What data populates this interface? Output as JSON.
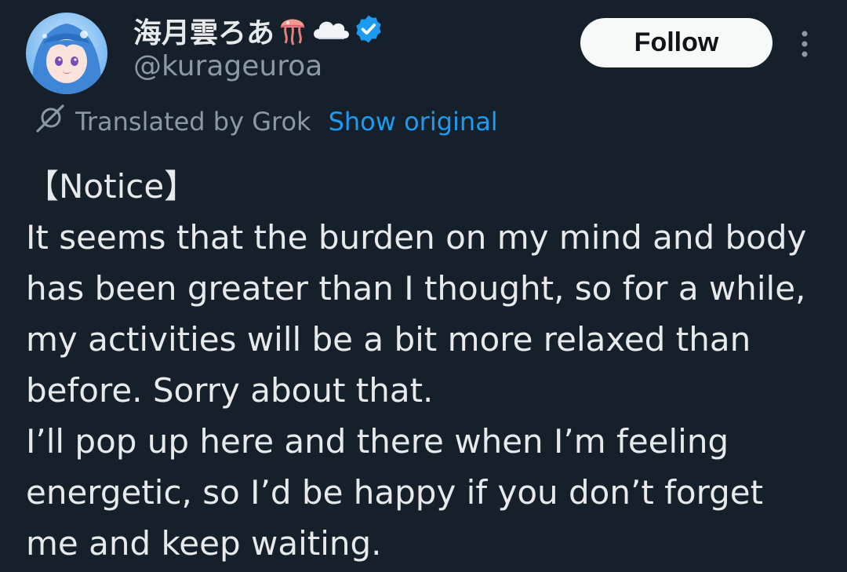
{
  "author": {
    "display_name": "海月雲ろあ",
    "handle": "@kurageuroa",
    "verified": true
  },
  "actions": {
    "follow_label": "Follow"
  },
  "translation": {
    "label": "Translated by Grok",
    "show_original_label": "Show original"
  },
  "tweet": {
    "text": "【Notice】\nIt seems that the burden on my mind and body has been greater than I thought, so for a while, my activities will be a bit more relaxed than before. Sorry about that.\nI’ll pop up here and there when I’m feeling energetic, so I’d be happy if you don’t forget me and keep waiting."
  },
  "icons": {
    "name_emojis": [
      "jellyfish-icon",
      "cloud-icon"
    ],
    "verified": "verified-badge-icon",
    "more": "more-options-icon",
    "grok": "grok-icon"
  },
  "colors": {
    "background": "#15202b",
    "text_primary": "#e7e9ea",
    "text_secondary": "#8b98a5",
    "accent": "#1d9bf0",
    "button_bg": "#f7f9f9",
    "button_text": "#0f1419"
  }
}
